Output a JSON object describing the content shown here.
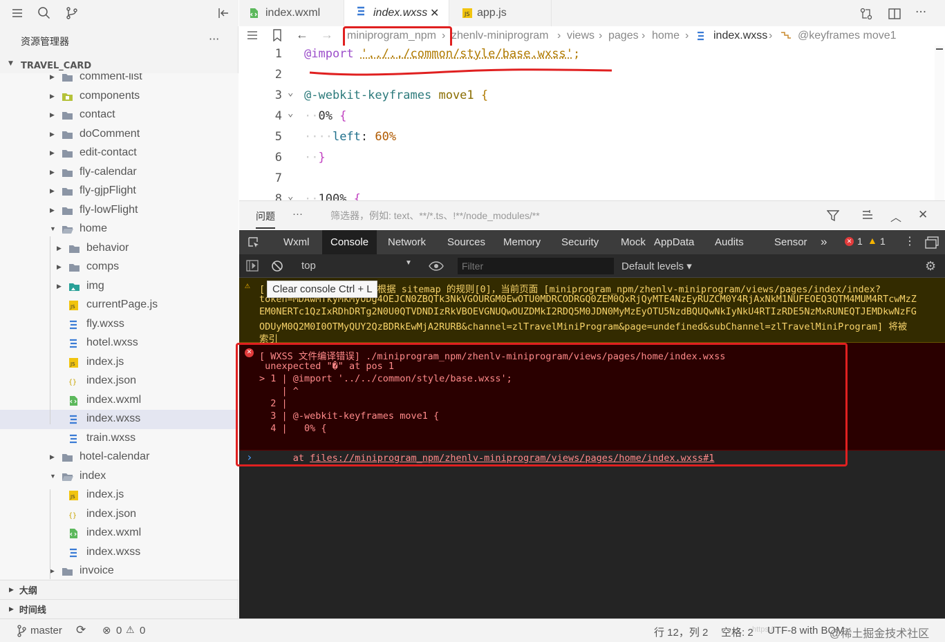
{
  "sidebar": {
    "explorer_title": "资源管理器",
    "more": "···",
    "project": "TRAVEL_CARD",
    "tree": [
      {
        "label": "comment-list",
        "type": "folder",
        "depth": 0,
        "arrow": "▸"
      },
      {
        "label": "components",
        "type": "folder-special",
        "depth": 0,
        "arrow": "▸"
      },
      {
        "label": "contact",
        "type": "folder",
        "depth": 0,
        "arrow": "▸"
      },
      {
        "label": "doComment",
        "type": "folder",
        "depth": 0,
        "arrow": "▸"
      },
      {
        "label": "edit-contact",
        "type": "folder",
        "depth": 0,
        "arrow": "▸"
      },
      {
        "label": "fly-calendar",
        "type": "folder",
        "depth": 0,
        "arrow": "▸"
      },
      {
        "label": "fly-gjpFlight",
        "type": "folder",
        "depth": 0,
        "arrow": "▸"
      },
      {
        "label": "fly-lowFlight",
        "type": "folder",
        "depth": 0,
        "arrow": "▸"
      },
      {
        "label": "home",
        "type": "folder-open",
        "depth": 0,
        "arrow": "▾"
      },
      {
        "label": "behavior",
        "type": "folder",
        "depth": 1,
        "arrow": "▸"
      },
      {
        "label": "comps",
        "type": "folder",
        "depth": 1,
        "arrow": "▸"
      },
      {
        "label": "img",
        "type": "folder-img",
        "depth": 1,
        "arrow": "▸"
      },
      {
        "label": "currentPage.js",
        "type": "js",
        "depth": 1,
        "arrow": ""
      },
      {
        "label": "fly.wxss",
        "type": "wxss",
        "depth": 1,
        "arrow": ""
      },
      {
        "label": "hotel.wxss",
        "type": "wxss",
        "depth": 1,
        "arrow": ""
      },
      {
        "label": "index.js",
        "type": "js",
        "depth": 1,
        "arrow": ""
      },
      {
        "label": "index.json",
        "type": "json",
        "depth": 1,
        "arrow": ""
      },
      {
        "label": "index.wxml",
        "type": "wxml",
        "depth": 1,
        "arrow": ""
      },
      {
        "label": "index.wxss",
        "type": "wxss",
        "depth": 1,
        "arrow": "",
        "selected": true
      },
      {
        "label": "train.wxss",
        "type": "wxss",
        "depth": 1,
        "arrow": ""
      },
      {
        "label": "hotel-calendar",
        "type": "folder",
        "depth": 0,
        "arrow": "▸"
      },
      {
        "label": "index",
        "type": "folder-open",
        "depth": 0,
        "arrow": "▾"
      },
      {
        "label": "index.js",
        "type": "js",
        "depth": 1,
        "arrow": ""
      },
      {
        "label": "index.json",
        "type": "json",
        "depth": 1,
        "arrow": ""
      },
      {
        "label": "index.wxml",
        "type": "wxml",
        "depth": 1,
        "arrow": ""
      },
      {
        "label": "index.wxss",
        "type": "wxss",
        "depth": 1,
        "arrow": ""
      },
      {
        "label": "invoice",
        "type": "folder",
        "depth": 0,
        "arrow": "▸"
      }
    ],
    "outline": "大纲",
    "timeline": "时间线"
  },
  "status": {
    "branch": "master",
    "errors": "0",
    "warnings": "0",
    "position": "行 12，列 2",
    "spaces": "空格: 2",
    "encoding": "UTF-8 with BOM",
    "watermark": "@稀土掘金技术社区",
    "watermark_faint": "https://..."
  },
  "tabs": [
    {
      "label": "index.wxml",
      "icon": "wxml"
    },
    {
      "label": "index.wxss",
      "icon": "wxss",
      "active": true,
      "close": "✕"
    },
    {
      "label": "app.js",
      "icon": "js"
    }
  ],
  "breadcrumb": [
    "miniprogram_npm",
    "zhenlv-miniprogram",
    "views",
    "pages",
    "home",
    "index.wxss",
    "@keyframes move1"
  ],
  "editor": {
    "lines": [
      {
        "n": "1",
        "parts": [
          [
            "@import ",
            "#9b4dca"
          ],
          [
            "'../../common/style/base.wxss'",
            "#b07a00"
          ],
          [
            ";",
            "#b07a00"
          ]
        ]
      },
      {
        "n": "2",
        "parts": []
      },
      {
        "n": "3",
        "fold": true,
        "parts": [
          [
            "@-webkit-keyframes ",
            "#2c7a7b"
          ],
          [
            "move1 ",
            "#8a6d00"
          ],
          [
            "{",
            "#b07a00"
          ]
        ]
      },
      {
        "n": "4",
        "fold": true,
        "parts": [
          [
            "··",
            "#ccc"
          ],
          [
            "0% ",
            "#333"
          ],
          [
            "{",
            "#c040c0"
          ]
        ]
      },
      {
        "n": "5",
        "parts": [
          [
            "····",
            "#ccc"
          ],
          [
            "left",
            "#1f6f8b"
          ],
          [
            ": ",
            "#333"
          ],
          [
            "60%",
            "#b05a00"
          ]
        ]
      },
      {
        "n": "6",
        "parts": [
          [
            "··",
            "#ccc"
          ],
          [
            "}",
            "#c040c0"
          ]
        ]
      },
      {
        "n": "7",
        "parts": []
      },
      {
        "n": "8",
        "fold": true,
        "parts": [
          [
            "··",
            "#ccc"
          ],
          [
            "100% ",
            "#333"
          ],
          [
            "{",
            "#c040c0"
          ]
        ]
      }
    ]
  },
  "problems": {
    "tab": "问题",
    "more": "···",
    "filter_placeholder": "筛选器，例如: text、**/*.ts、!**/node_modules/**"
  },
  "devtools": {
    "tabs": [
      "Wxml",
      "Console",
      "Network",
      "Sources",
      "Memory",
      "Security",
      "Mock",
      "AppData",
      "Audits",
      "Sensor"
    ],
    "active_tab": "Console",
    "more_tabs": "»",
    "error_count": "1",
    "warning_count": "1",
    "context": "top",
    "filter_placeholder": "Filter",
    "levels": "Default levels ▾",
    "tooltip": "Clear console  Ctrl + L"
  },
  "console": {
    "warning_lines": [
      "[                    根据 sitemap 的规则[0]，当前页面 [miniprogram_npm/zhenlv-miniprogram/views/pages/index/index?",
      "token=MDAwMTkyMkMyODg4OEJCN0ZBQTk3NkVGOURGM0EwOTU0MDRCODRGQ0ZEM0QxRjQyMTE4NzEyRUZCM0Y4RjAxNkM1NUFEOEQ3QTM4MUM4RTcwMzZ",
      "EM0NERTc1QzIxRDhDRTg2N0U0QTVDNDIzRkVBOEVGNUQwOUZDMkI2RDQ5M0JDN0MyMzEyOTU5NzdBQUQwNkIyNkU4RTIzRDE5NzMxRUNEQTJEMDkwNzFG",
      "ODUyM0Q2M0I0OTMyQUY2QzBDRkEwMjA2RURB&channel=zlTravelMiniProgram&page=undefined&subChannel=zlTravelMiniProgram] 将被",
      "索引"
    ],
    "error_lines": [
      "[ WXSS 文件编译错误] ./miniprogram_npm/zhenlv-miniprogram/views/pages/home/index.wxss",
      " unexpected \"�\" at pos 1",
      "> 1 | @import '../../common/style/base.wxss';",
      "    | ^",
      "  2 |",
      "  3 | @-webkit-keyframes move1 {",
      "  4 |   0% {"
    ],
    "error_at": "at ",
    "error_link": "files://miniprogram_npm/zhenlv-miniprogram/views/pages/home/index.wxss#1",
    "prompt": "›"
  },
  "colors": {
    "annotation": "#e02020",
    "selection": "#e4e6f1",
    "console_bg": "#242424"
  }
}
